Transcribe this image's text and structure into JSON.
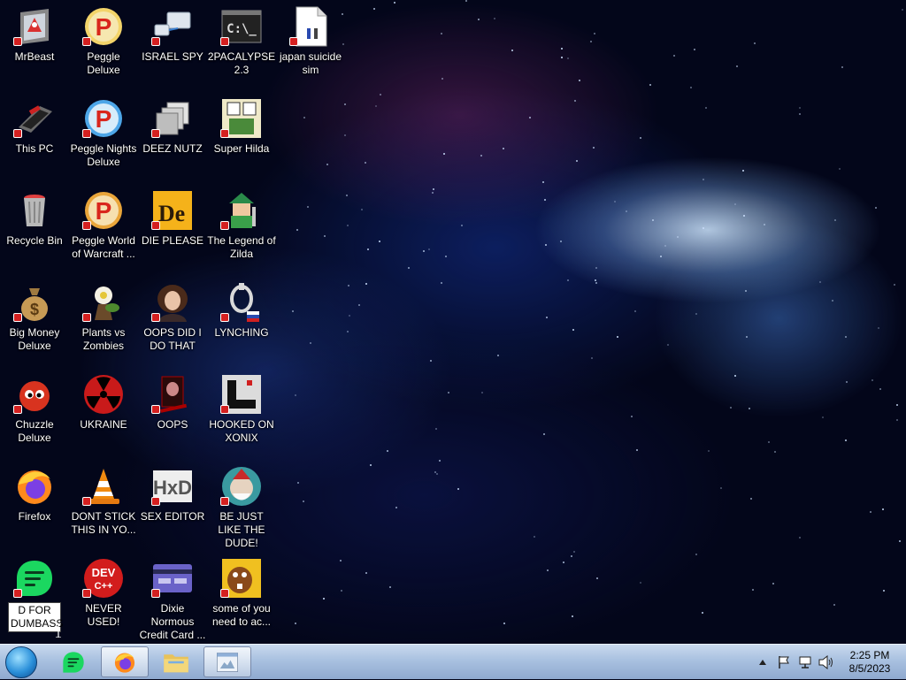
{
  "desktop": {
    "icons": [
      {
        "id": "mrbeast",
        "label": "MrBeast",
        "icon": "mrbeast-icon"
      },
      {
        "id": "this-pc",
        "label": "This PC",
        "icon": "computer-icon"
      },
      {
        "id": "recycle-bin",
        "label": "Recycle Bin",
        "icon": "recycle-bin-icon"
      },
      {
        "id": "big-money",
        "label": "Big Money Deluxe",
        "icon": "money-bag-icon"
      },
      {
        "id": "chuzzle",
        "label": "Chuzzle Deluxe",
        "icon": "chuzzle-icon"
      },
      {
        "id": "firefox",
        "label": "Firefox",
        "icon": "firefox-icon"
      },
      {
        "id": "d-for-dumbass",
        "label": "D FOR DUMBASS",
        "icon": "green-chat-icon"
      },
      {
        "id": "peggle",
        "label": "Peggle Deluxe",
        "icon": "peggle-icon"
      },
      {
        "id": "peggle-nights",
        "label": "Peggle Nights Deluxe",
        "icon": "peggle-nights-icon"
      },
      {
        "id": "peggle-wow",
        "label": "Peggle World of Warcraft ...",
        "icon": "peggle-icon"
      },
      {
        "id": "pvz",
        "label": "Plants vs Zombies",
        "icon": "plants-vs-zombies-icon"
      },
      {
        "id": "ukraine",
        "label": "UKRAINE",
        "icon": "radiation-icon"
      },
      {
        "id": "vlc",
        "label": "DONT STICK THIS IN YO...",
        "icon": "traffic-cone-icon"
      },
      {
        "id": "devcpp",
        "label": "NEVER USED!",
        "icon": "dev-cpp-icon"
      },
      {
        "id": "israel-spy",
        "label": "ISRAEL SPY",
        "icon": "network-icon"
      },
      {
        "id": "deez-nutz",
        "label": "DEEZ NUTZ",
        "icon": "windows-stack-icon"
      },
      {
        "id": "die-please",
        "label": "DIE PLEASE",
        "icon": "de-icon"
      },
      {
        "id": "oops-did-i",
        "label": "OOPS DID I DO THAT",
        "icon": "portrait-icon"
      },
      {
        "id": "oops",
        "label": "OOPS",
        "icon": "skull-card-icon"
      },
      {
        "id": "sex-editor",
        "label": "SEX EDITOR",
        "icon": "hxd-icon"
      },
      {
        "id": "dixie",
        "label": "Dixie Normous Credit Card ...",
        "icon": "credit-card-icon"
      },
      {
        "id": "2pacalypse",
        "label": "2PACALYPSE 2.3",
        "icon": "terminal-icon"
      },
      {
        "id": "super-hilda",
        "label": "Super Hilda",
        "icon": "pixel-character-icon"
      },
      {
        "id": "zilda",
        "label": "The Legend of Zilda",
        "icon": "zelda-icon"
      },
      {
        "id": "lynching",
        "label": "LYNCHING",
        "icon": "noose-icon"
      },
      {
        "id": "xonix",
        "label": "HOOKED ON XONIX",
        "icon": "xonix-icon"
      },
      {
        "id": "dude",
        "label": "BE JUST LIKE THE DUDE!",
        "icon": "elf-icon"
      },
      {
        "id": "some-of-you",
        "label": "some of you need to ac...",
        "icon": "beaver-icon"
      },
      {
        "id": "japan",
        "label": "japan suicide sim",
        "icon": "document-icon"
      }
    ]
  },
  "taskbar": {
    "pinned": [
      {
        "id": "green-app",
        "icon": "green-chat-icon"
      },
      {
        "id": "firefox",
        "icon": "firefox-icon"
      },
      {
        "id": "explorer",
        "icon": "folder-icon"
      },
      {
        "id": "window",
        "icon": "window-icon"
      }
    ],
    "clock": {
      "time": "2:25 PM",
      "date": "8/5/2023"
    }
  },
  "colors": {
    "accent": "#2a8fd9",
    "shortcut_badge": "#d42020",
    "taskbar": "#a9c1e0"
  }
}
